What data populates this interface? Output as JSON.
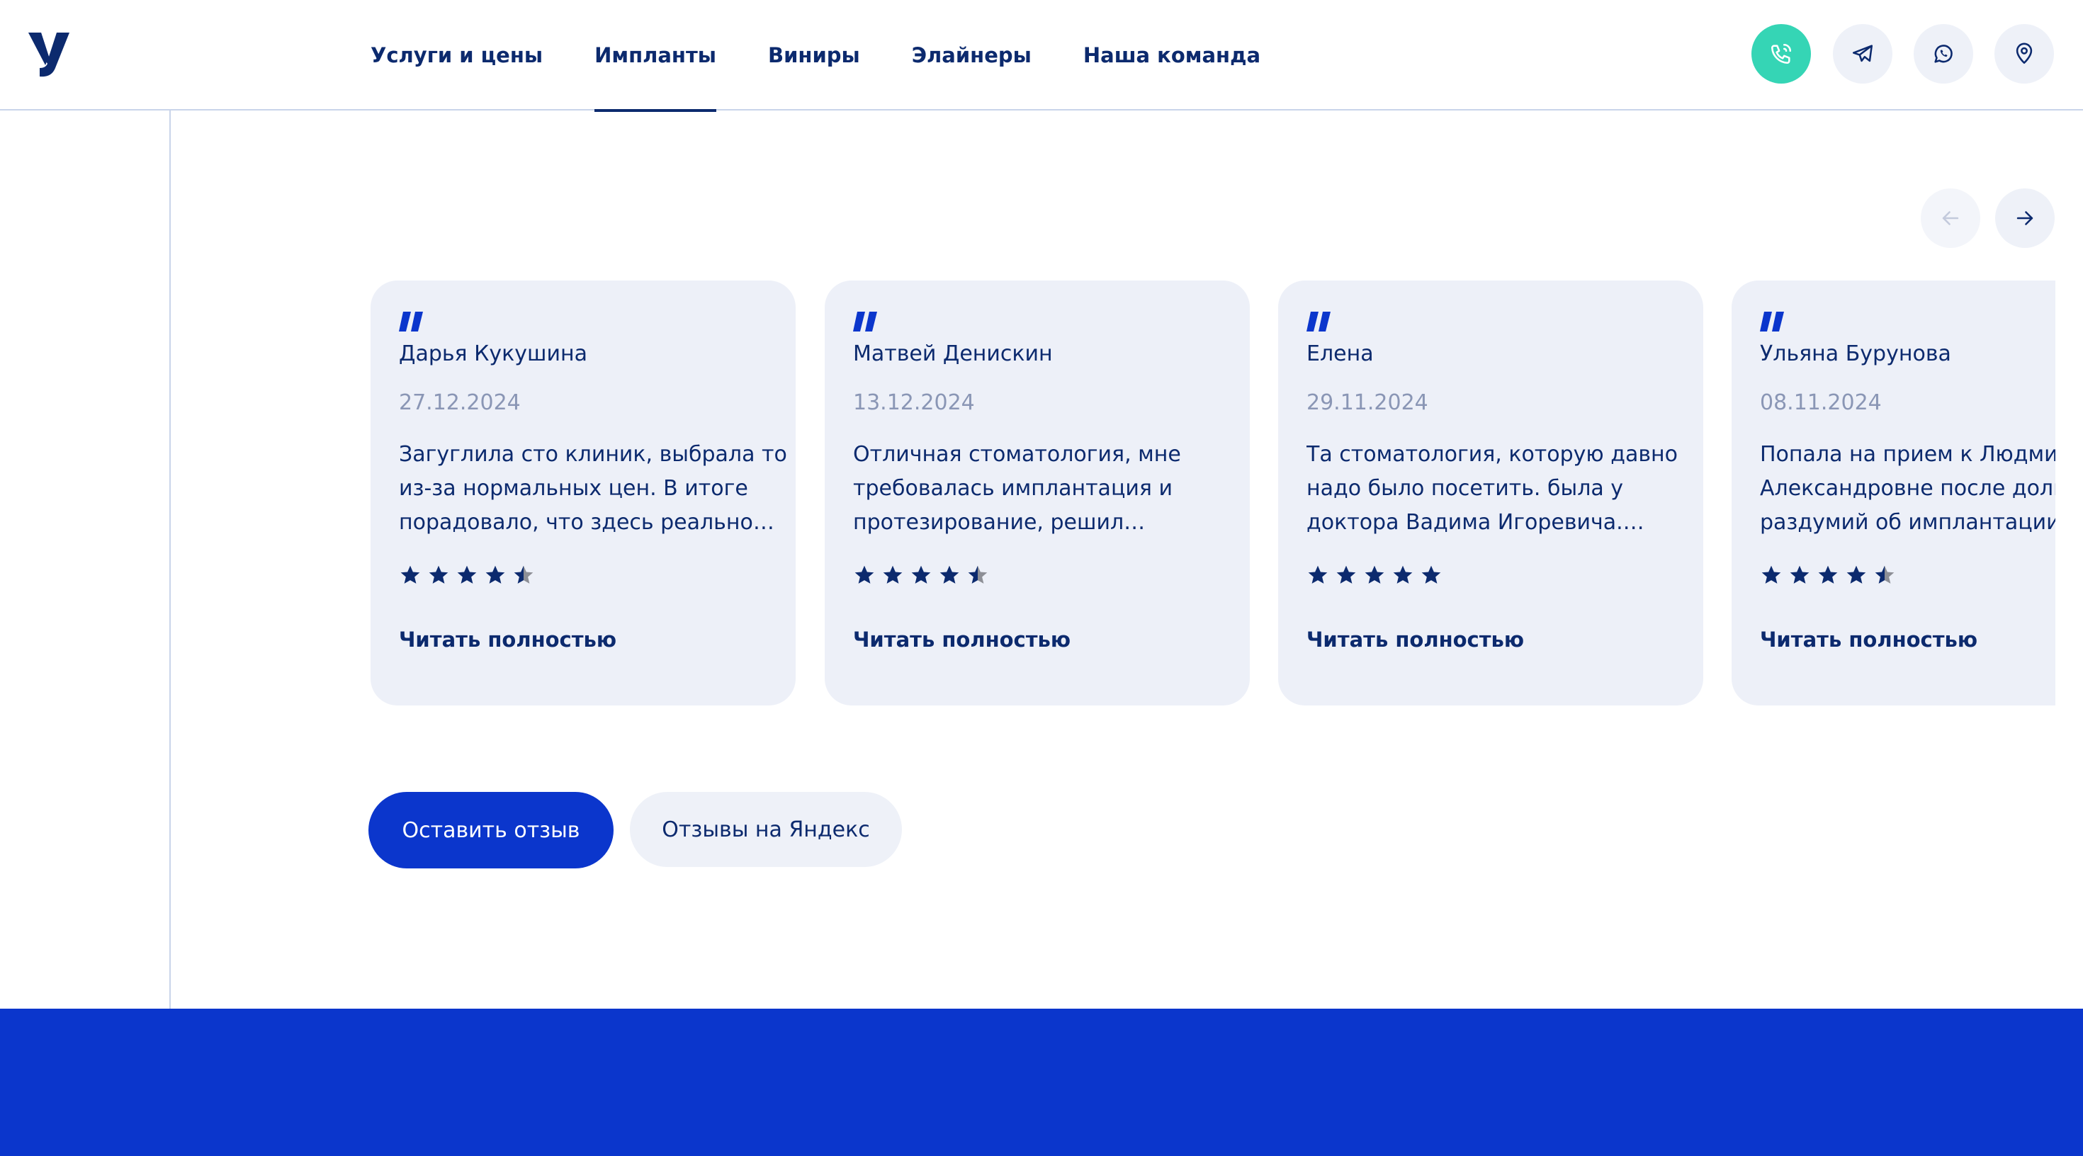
{
  "header": {
    "nav": [
      {
        "label": "Услуги и цены",
        "active": false
      },
      {
        "label": "Импланты",
        "active": true
      },
      {
        "label": "Виниры",
        "active": false
      },
      {
        "label": "Элайнеры",
        "active": false
      },
      {
        "label": "Наша команда",
        "active": false
      }
    ],
    "icons": [
      "phone-icon",
      "telegram-icon",
      "whatsapp-icon",
      "location-pin-icon"
    ]
  },
  "reviews": [
    {
      "name": "Дарья Кукушина",
      "date": "27.12.2024",
      "text": "Загуглила сто клиник, выбрала то из-за нормальных цен. В итоге порадовало, что здесь реально…",
      "rating": 4.5,
      "read_more": "Читать полностью"
    },
    {
      "name": "Матвей Денискин",
      "date": "13.12.2024",
      "text": "Отличная стоматология, мне требовалась имплантация и протезирование, решил…",
      "rating": 4.5,
      "read_more": "Читать полностью"
    },
    {
      "name": "Елена",
      "date": "29.11.2024",
      "text": "Та стоматология, которую давно надо было посетить. была у доктора Вадима Игоревича.…",
      "rating": 5,
      "read_more": "Читать полностью"
    },
    {
      "name": "Ульяна Бурунова",
      "date": "08.11.2024",
      "text": "Попала на прием к Людмиле Александровне после долгих раздумий об имплантации.",
      "rating": 4.5,
      "read_more": "Читать полностью"
    }
  ],
  "actions": {
    "leave_review": "Оставить отзыв",
    "yandex_reviews": "Отзывы на Яндекс"
  },
  "colors": {
    "primary": "#0b36cc",
    "navy": "#0c2a6e",
    "accent_green": "#35d5b5",
    "card_bg": "#edf0f8",
    "muted": "#8a96b5"
  }
}
